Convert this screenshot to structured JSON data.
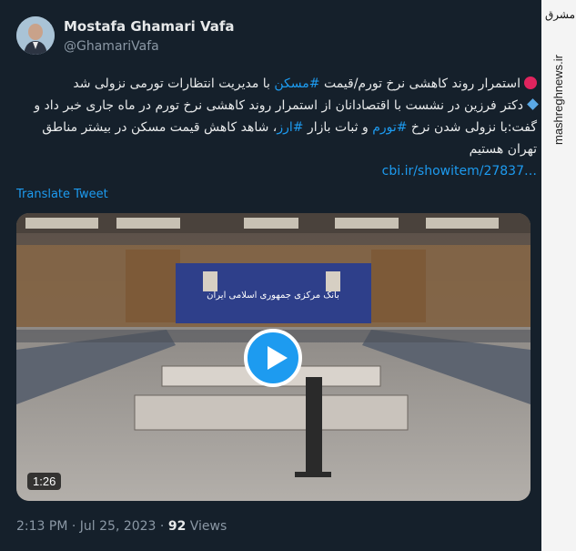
{
  "author": {
    "name": "Mostafa Ghamari Vafa",
    "handle": "@GhamariVafa"
  },
  "tweet": {
    "line1_pre": "استمرار روند کاهشی نرخ تورم/قیمت ",
    "line1_tag": "#مسکن",
    "line1_post": " با مدیریت انتظارات تورمی نزولی شد",
    "line2_pre": "دکتر فرزین در نشست با اقتصادانان از استمرار روند کاهشی نرخ تورم در ماه جاری خبر داد و گفت:با نزولی شدن نرخ ",
    "line2_tag1": "#تورم",
    "line2_mid": " و ثبات بازار ",
    "line2_tag2": "#ارز",
    "line2_post": "، شاهد کاهش قیمت مسکن در بیشتر مناطق تهران هستیم",
    "link": "cbi.ir/showitem/27837…",
    "translate": "Translate Tweet"
  },
  "video": {
    "duration": "1:26",
    "banner_text": "بانک مرکزی جمهوری اسلامی ایران"
  },
  "meta": {
    "time": "2:13 PM",
    "date": "Jul 25, 2023",
    "views_count": "92",
    "views_label": "Views"
  },
  "watermark": {
    "logo": "مشرق",
    "url": "mashreghnews.ir"
  },
  "colors": {
    "background": "#15202b",
    "accent": "#1d9bf0",
    "text": "#e7e9ea",
    "muted": "#8b98a5"
  }
}
